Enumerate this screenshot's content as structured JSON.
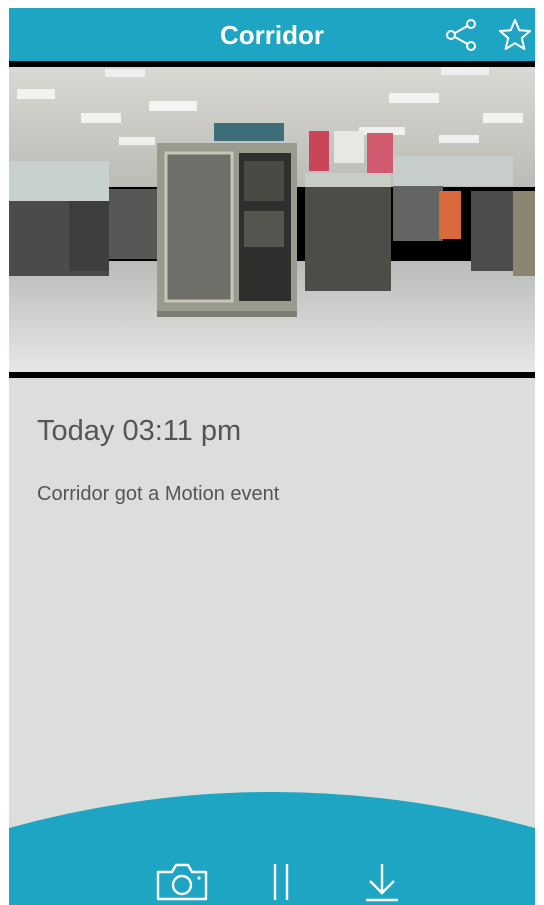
{
  "header": {
    "title": "Corridor",
    "share_icon": "share-icon",
    "star_icon": "star-outline-icon"
  },
  "event": {
    "time": "Today 03:11 pm",
    "description": "Corridor got a Motion event"
  },
  "controls": {
    "snapshot_icon": "camera-icon",
    "pause_icon": "pause-icon",
    "download_icon": "download-icon"
  },
  "colors": {
    "accent": "#1fa5c4",
    "background": "#dcdedd",
    "text": "#555555"
  }
}
